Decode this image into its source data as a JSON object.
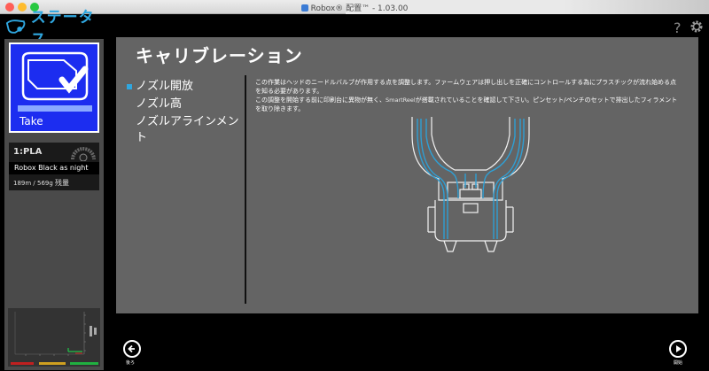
{
  "window": {
    "title": "Robox® 配置™ - 1.03.00"
  },
  "sidebar": {
    "brand_title": "ステータス",
    "printer": {
      "name": "Take",
      "color": "#1c2df0"
    },
    "filament": {
      "slot": "1:PLA",
      "name": "Robox Black as night",
      "remaining": "189m / 569g",
      "remaining_label": "残量"
    }
  },
  "main": {
    "title": "キャリブレーション",
    "steps": [
      {
        "label": "ノズル開放",
        "active": true
      },
      {
        "label": "ノズル高",
        "active": false
      },
      {
        "label": "ノズルアラインメント",
        "active": false
      }
    ],
    "description": {
      "line1": "この作業はヘッドのニードルバルブが作用する点を調整します。ファームウェアは押し出しを正確にコントロールする為にプラスチックが流れ始める点",
      "line2": "を知る必要があります。",
      "line3_a": "この調整を開始する前に印刷台に異物が無く、",
      "line3_b": "SmartReel",
      "line3_c": "が搭載されていることを確認して下さい。ピンセット/ペンチのセットで排出したフィラメント",
      "line4": "を取り除きます。"
    },
    "back_label": "後ろ",
    "start_label": "開始"
  },
  "colors": {
    "accent": "#2fa7e0",
    "panel": "#646464",
    "sidebar_panel": "#4a4a4a"
  }
}
